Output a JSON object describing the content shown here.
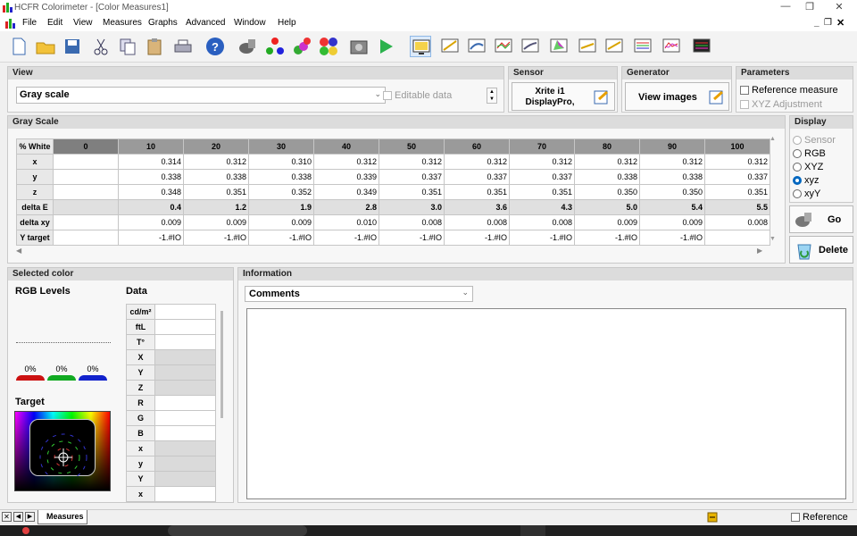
{
  "window": {
    "title": "HCFR Colorimeter - [Color Measures1]"
  },
  "menu": [
    "File",
    "Edit",
    "View",
    "Measures",
    "Graphs",
    "Advanced",
    "Window",
    "Help"
  ],
  "toolbar_icons": [
    "new-document-icon",
    "open-folder-icon",
    "save-icon",
    "cut-icon",
    "copy-icon",
    "paste-icon",
    "print-icon",
    "help-icon",
    "sensor-probe-icon",
    "rgb-dots-icon",
    "colorimeter-icon",
    "color-wheel-icon",
    "camera-icon",
    "play-icon",
    "monitor-view-icon",
    "graph-luminance-icon",
    "graph-gamma-icon",
    "graph-rgb-icon",
    "graph-deltae-icon",
    "graph-cie-icon",
    "graph-temp-icon",
    "graph-saturation-icon",
    "graph-multi-icon",
    "graph-spectrum-icon",
    "graph-bars-icon"
  ],
  "view_panel": {
    "header": "View",
    "select_value": "Gray scale",
    "editable_label": "Editable data"
  },
  "sensor_panel": {
    "header": "Sensor",
    "name_line1": "Xrite i1",
    "name_line2": "DisplayPro,"
  },
  "generator_panel": {
    "header": "Generator",
    "button_label": "View images"
  },
  "parameters_panel": {
    "header": "Parameters",
    "reference_measure": "Reference measure",
    "xyz_adjustment": "XYZ Adjustment"
  },
  "grayscale": {
    "header": "Gray Scale",
    "row_header": "% White",
    "columns": [
      "0",
      "10",
      "20",
      "30",
      "40",
      "50",
      "60",
      "70",
      "80",
      "90",
      "100"
    ],
    "rows": [
      {
        "label": "x",
        "bold": false,
        "values": [
          "",
          "0.314",
          "0.312",
          "0.310",
          "0.312",
          "0.312",
          "0.312",
          "0.312",
          "0.312",
          "0.312",
          "0.312"
        ]
      },
      {
        "label": "y",
        "bold": false,
        "values": [
          "",
          "0.338",
          "0.338",
          "0.338",
          "0.339",
          "0.337",
          "0.337",
          "0.337",
          "0.338",
          "0.338",
          "0.337"
        ]
      },
      {
        "label": "z",
        "bold": false,
        "values": [
          "",
          "0.348",
          "0.351",
          "0.352",
          "0.349",
          "0.351",
          "0.351",
          "0.351",
          "0.350",
          "0.350",
          "0.351"
        ]
      },
      {
        "label": "delta E",
        "bold": true,
        "values": [
          "",
          "0.4",
          "1.2",
          "1.9",
          "2.8",
          "3.0",
          "3.6",
          "4.3",
          "5.0",
          "5.4",
          "5.5"
        ]
      },
      {
        "label": "delta xy",
        "bold": false,
        "values": [
          "",
          "0.009",
          "0.009",
          "0.009",
          "0.010",
          "0.008",
          "0.008",
          "0.008",
          "0.009",
          "0.009",
          "0.008"
        ]
      },
      {
        "label": "Y target",
        "bold": false,
        "values": [
          "",
          "-1.#IO",
          "-1.#IO",
          "-1.#IO",
          "-1.#IO",
          "-1.#IO",
          "-1.#IO",
          "-1.#IO",
          "-1.#IO",
          "-1.#IO",
          ""
        ]
      }
    ]
  },
  "display_panel": {
    "header": "Display",
    "options": [
      {
        "label": "Sensor",
        "state": "disabled"
      },
      {
        "label": "RGB",
        "state": "off"
      },
      {
        "label": "XYZ",
        "state": "off"
      },
      {
        "label": "xyz",
        "state": "on"
      },
      {
        "label": "xyY",
        "state": "off"
      }
    ],
    "go_label": "Go",
    "delete_label": "Delete"
  },
  "selected_color": {
    "header": "Selected color",
    "rgb_levels_label": "RGB Levels",
    "data_label": "Data",
    "levels": [
      "0%",
      "0%",
      "0%"
    ],
    "level_colors": [
      "#cc1111",
      "#11aa22",
      "#1122cc"
    ],
    "target_label": "Target",
    "data_rows": [
      "cd/m²",
      "ftL",
      "T°",
      "X",
      "Y",
      "Z",
      "R",
      "G",
      "B",
      "x",
      "y",
      "Y",
      "x"
    ]
  },
  "information": {
    "header": "Information",
    "select_value": "Comments"
  },
  "statusbar": {
    "tab_label": "Measures",
    "reference_label": "Reference"
  }
}
